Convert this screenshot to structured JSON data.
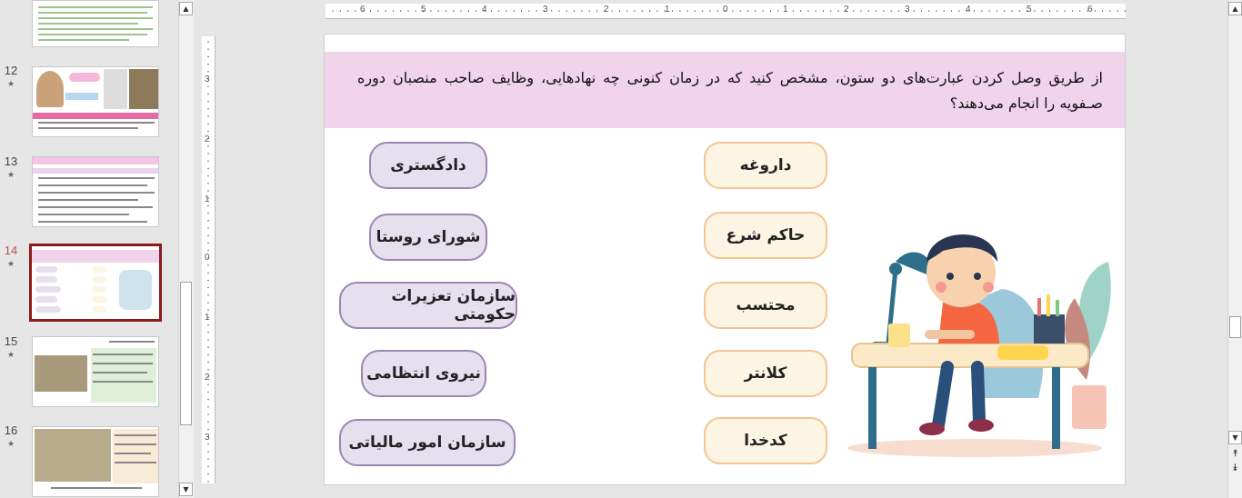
{
  "thumbnails": [
    {
      "number": "",
      "starred": false
    },
    {
      "number": "12",
      "starred": true
    },
    {
      "number": "13",
      "starred": true
    },
    {
      "number": "14",
      "starred": true,
      "selected": true
    },
    {
      "number": "15",
      "starred": true
    },
    {
      "number": "16",
      "starred": true
    }
  ],
  "star_glyph": "★",
  "ruler": {
    "horizontal": [
      "6",
      "5",
      "4",
      "3",
      "2",
      "1",
      "0",
      "1",
      "2",
      "3",
      "4",
      "5",
      "6"
    ],
    "vertical": [
      "3",
      "2",
      "1",
      "0",
      "1",
      "2",
      "3"
    ]
  },
  "slide": {
    "question": "از طریق وصل کردن عبارت‌های دو ستون، مشخص کنید که در زمان کنونی چه نهادهایی، وظایف صاحب منصبان دوره صـفویه را انجام می‌دهند؟",
    "right_column": [
      "داروغه",
      "حاکم شرع",
      "محتسب",
      "کلانتر",
      "کدخدا"
    ],
    "left_column": [
      "دادگستری",
      "شورای روستا",
      "سازمان تعزیرات حکومتی",
      "نیروی انتظامی",
      "سازمان امور مالیاتی"
    ],
    "colors": {
      "question_bg": "#f1d3eb",
      "right_pill_bg": "#fdf5e3",
      "right_pill_border": "#f3c491",
      "left_pill_bg": "#e6e0ee",
      "left_pill_border": "#9b87b3"
    },
    "illustration": "boy-studying-at-desk-illustration"
  },
  "icons": {
    "scroll_up": "▲",
    "scroll_down": "▼",
    "prev_slide": "⯭",
    "next_slide": "⯯"
  }
}
